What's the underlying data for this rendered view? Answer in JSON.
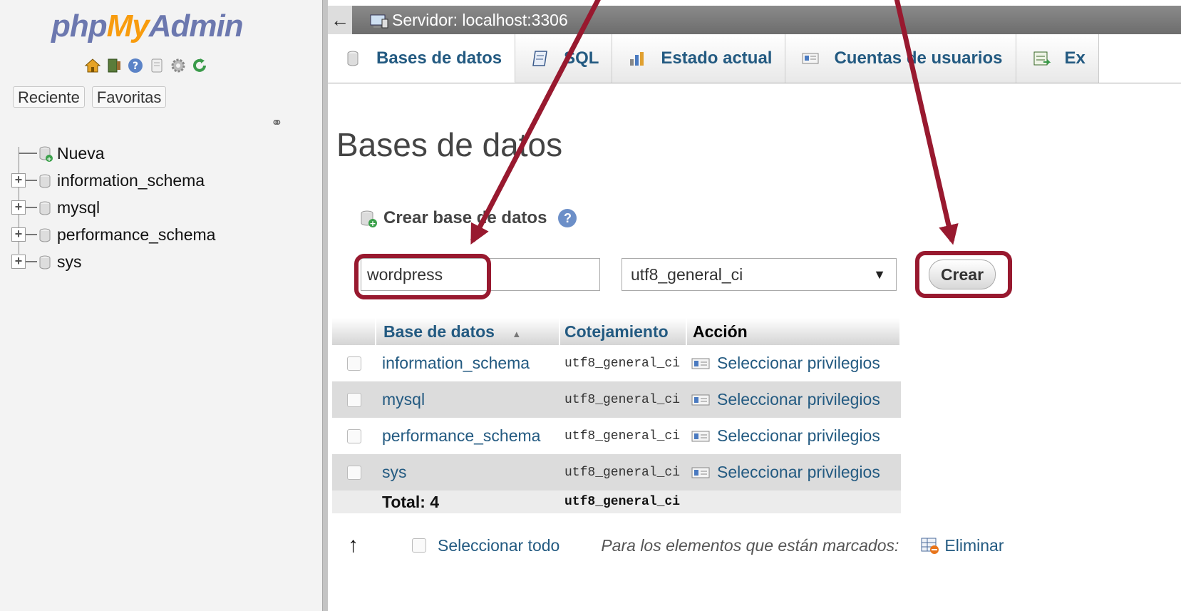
{
  "sidebar": {
    "logo": {
      "php": "php",
      "my": "My",
      "admin": "Admin"
    },
    "quick_icons": [
      "home-icon",
      "exit-icon",
      "help-icon",
      "docs-icon",
      "settings-icon",
      "reload-icon"
    ],
    "buttons": {
      "recent": "Reciente",
      "favorites": "Favoritas"
    },
    "tree": [
      {
        "label": "Nueva",
        "icon": "new-database-icon"
      },
      {
        "label": "information_schema",
        "icon": "database-icon"
      },
      {
        "label": "mysql",
        "icon": "database-icon"
      },
      {
        "label": "performance_schema",
        "icon": "database-icon"
      },
      {
        "label": "sys",
        "icon": "database-icon"
      }
    ]
  },
  "topbar": {
    "back": "←",
    "server": "Servidor: localhost:3306"
  },
  "tabs": [
    {
      "label": "Bases de datos",
      "icon": "database-icon"
    },
    {
      "label": "SQL",
      "icon": "sql-icon"
    },
    {
      "label": "Estado actual",
      "icon": "status-icon"
    },
    {
      "label": "Cuentas de usuarios",
      "icon": "users-icon"
    },
    {
      "label": "Ex",
      "icon": "export-icon"
    }
  ],
  "main": {
    "title": "Bases de datos",
    "create_label": "Crear base de datos",
    "db_name_value": "wordpress",
    "collation_selected": "utf8_general_ci",
    "create_button": "Crear"
  },
  "table": {
    "headers": {
      "name": "Base de datos",
      "sort": "▲",
      "collation": "Cotejamiento",
      "action": "Acción"
    },
    "rows": [
      {
        "name": "information_schema",
        "collation": "utf8_general_ci",
        "action": "Seleccionar privilegios"
      },
      {
        "name": "mysql",
        "collation": "utf8_general_ci",
        "action": "Seleccionar privilegios"
      },
      {
        "name": "performance_schema",
        "collation": "utf8_general_ci",
        "action": "Seleccionar privilegios"
      },
      {
        "name": "sys",
        "collation": "utf8_general_ci",
        "action": "Seleccionar privilegios"
      }
    ],
    "total_label": "Total: 4",
    "total_collation": "utf8_general_ci"
  },
  "bottom": {
    "up_arrow": "↑",
    "select_all": "Seleccionar todo",
    "marked": "Para los elementos que están marcados:",
    "delete": "Eliminar"
  },
  "colors": {
    "annotation": "#98192f",
    "link": "#235a81",
    "logo_blue": "#6c78af",
    "logo_orange": "#f89c0e"
  }
}
